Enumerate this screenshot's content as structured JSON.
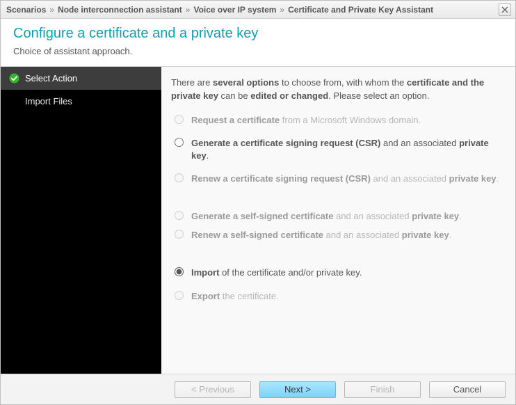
{
  "titlebar": {
    "crumbs": [
      "Scenarios",
      "Node interconnection assistant",
      "Voice over IP system",
      "Certificate and Private Key Assistant"
    ]
  },
  "header": {
    "title": "Configure a certificate and a private key",
    "subtitle": "Choice of assistant approach."
  },
  "sidebar": {
    "steps": [
      {
        "label": "Select Action",
        "active": true,
        "checked": true
      },
      {
        "label": "Import Files",
        "active": false,
        "checked": false
      }
    ]
  },
  "content": {
    "intro_parts": {
      "a": "There are ",
      "b": "several options",
      "c": " to choose from, with whom the ",
      "d": "certificate and the private key",
      "e": " can be ",
      "f": "edited or changed",
      "g": ". Please select an option."
    },
    "options": [
      {
        "enabled": false,
        "selected": false,
        "parts": {
          "a": "Request a certificate",
          "b": " from a Microsoft Windows domain."
        }
      },
      {
        "enabled": true,
        "selected": false,
        "parts": {
          "a": "Generate a certificate signing request (CSR)",
          "b": " and an associated ",
          "c": "private key",
          "d": "."
        }
      },
      {
        "enabled": false,
        "selected": false,
        "parts": {
          "a": "Renew a certificate signing request (CSR)",
          "b": " and an associated ",
          "c": "private key",
          "d": "."
        }
      },
      {
        "enabled": false,
        "selected": false,
        "parts": {
          "a": "Generate a self-signed certificate",
          "b": " and an associated ",
          "c": "private key",
          "d": "."
        }
      },
      {
        "enabled": false,
        "selected": false,
        "parts": {
          "a": "Renew a self-signed certificate",
          "b": " and an associated ",
          "c": "private key",
          "d": "."
        }
      },
      {
        "enabled": true,
        "selected": true,
        "parts": {
          "a": "Import",
          "b": " of the certificate and/or private key."
        }
      },
      {
        "enabled": false,
        "selected": false,
        "parts": {
          "a": "Export",
          "b": " the certificate."
        }
      }
    ]
  },
  "footer": {
    "previous": "< Previous",
    "next": "Next >",
    "finish": "Finish",
    "cancel": "Cancel"
  }
}
